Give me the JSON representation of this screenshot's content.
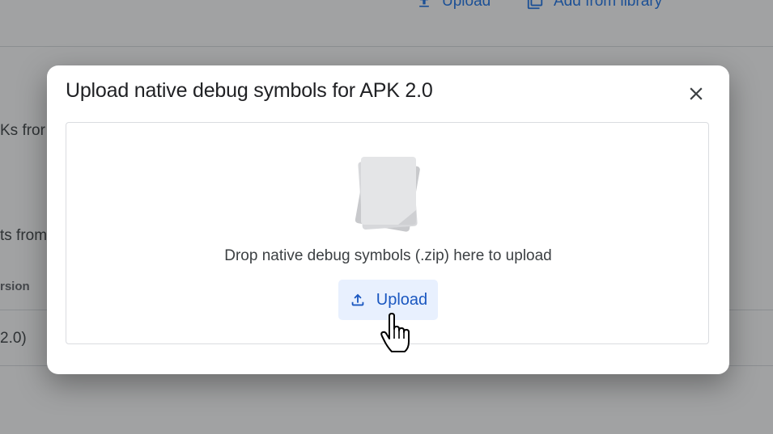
{
  "background": {
    "toolbar": {
      "upload_label": "Upload",
      "library_label": "Add from library"
    },
    "partial_text_1": "Ks fror",
    "partial_text_2": "ts from",
    "column_header": "rsion",
    "row_value": "2.0)"
  },
  "dialog": {
    "title": "Upload native debug symbols for APK 2.0",
    "close_icon": "close-icon",
    "dropzone": {
      "illustration_icon": "file-stack-icon",
      "instruction": "Drop native debug symbols (.zip) here to upload",
      "upload_button_label": "Upload",
      "upload_icon": "upload-icon"
    }
  },
  "colors": {
    "accent": "#1a73e8",
    "button_bg": "#e8f0fe",
    "button_text": "#1a57c0",
    "title_text": "#202124",
    "body_text": "#3c4043",
    "border": "#dadce0"
  }
}
